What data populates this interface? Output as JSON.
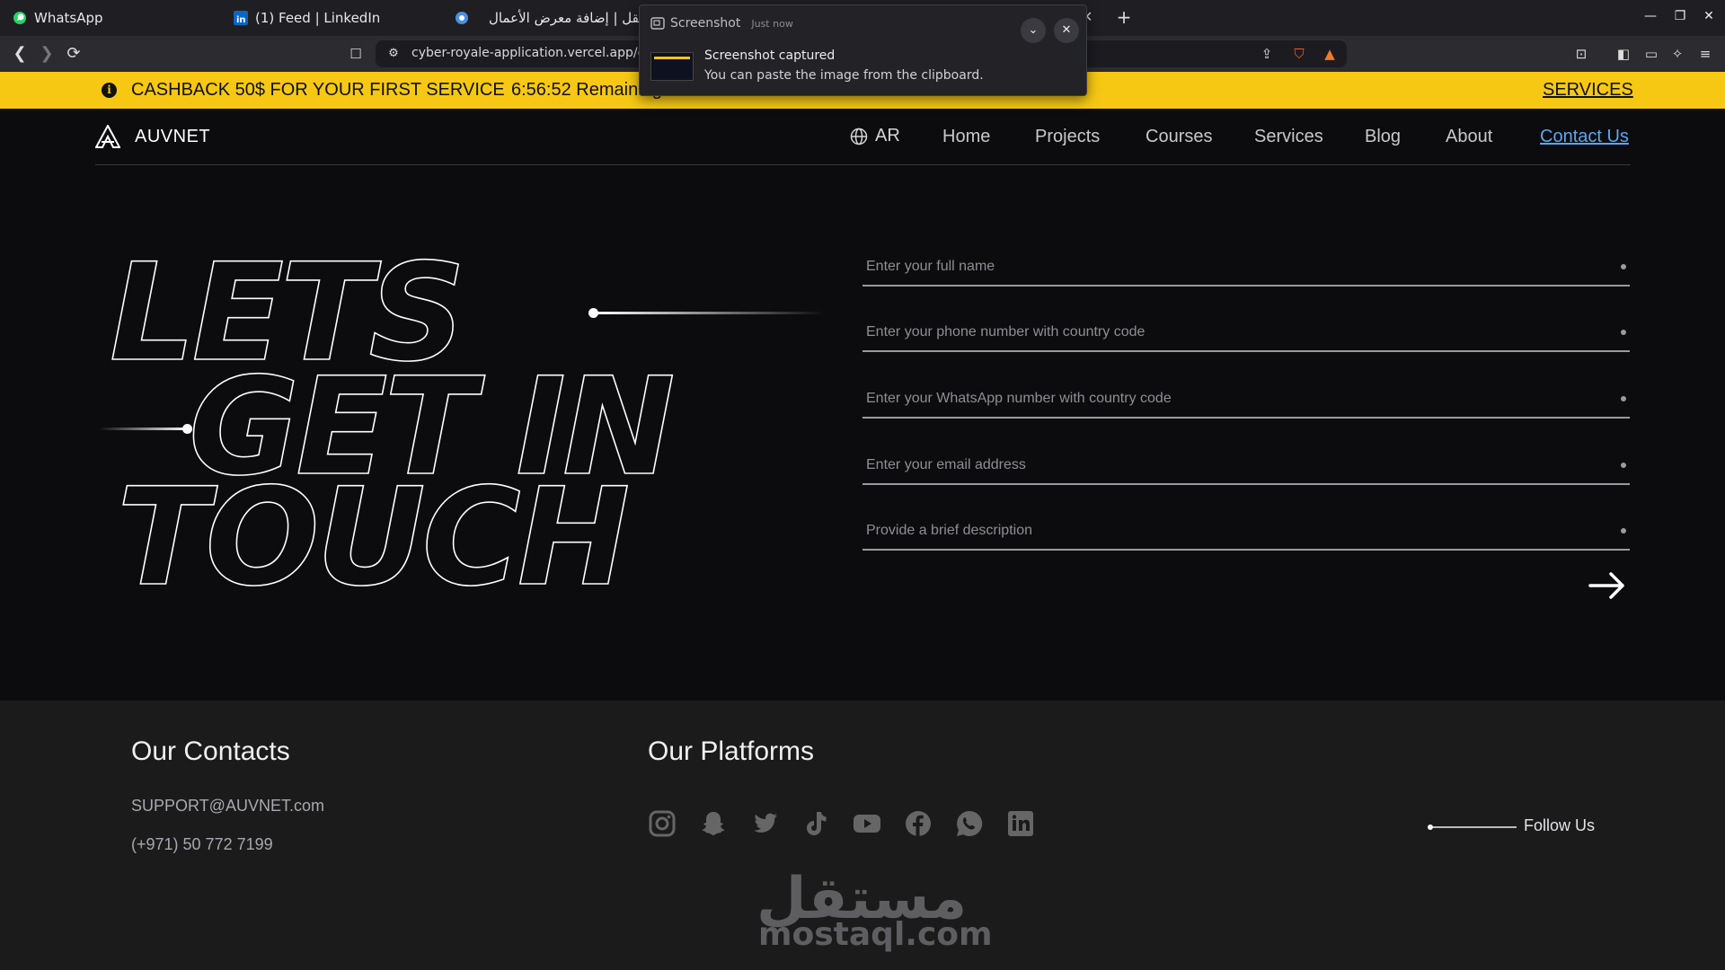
{
  "browser": {
    "tabs": [
      {
        "label": "WhatsApp",
        "icon": "whatsapp-icon"
      },
      {
        "label": "(1) Feed | LinkedIn",
        "icon": "linkedin-icon"
      },
      {
        "label": "مستقل | إضافة معرض الأعمال",
        "icon": "chrome-icon"
      }
    ],
    "new_tab": "+",
    "url": "cyber-royale-application.vercel.app/contact"
  },
  "notification": {
    "app": "Screenshot",
    "time": "Just now",
    "title": "Screenshot captured",
    "message": "You can paste the image from the clipboard."
  },
  "promo": {
    "text": "CASHBACK 50$ FOR YOUR FIRST SERVICE",
    "timer": "6:56:52 Remaining",
    "link": "SERVICES",
    "color": "#f6c814"
  },
  "header": {
    "brand": "AUVNET",
    "lang": "AR",
    "nav": [
      "Home",
      "Projects",
      "Courses",
      "Services",
      "Blog",
      "About",
      "Contact Us"
    ],
    "active": "Contact Us",
    "active_color": "#5aa7ee"
  },
  "hero": {
    "headline": [
      "LETS",
      "GET IN",
      "TOUCH"
    ]
  },
  "form": {
    "fields": [
      {
        "placeholder": "Enter your full name",
        "value": ""
      },
      {
        "placeholder": "Enter your phone number with country code",
        "value": ""
      },
      {
        "placeholder": "Enter your WhatsApp number with country code",
        "value": ""
      },
      {
        "placeholder": "Enter your email address",
        "value": ""
      },
      {
        "placeholder": "Provide a brief description",
        "value": ""
      }
    ],
    "submit_icon": "arrow-right-icon"
  },
  "footer": {
    "contacts_title": "Our Contacts",
    "email": "SUPPORT@AUVNET.com",
    "phone": "(+971) 50 772 7199",
    "platforms_title": "Our Platforms",
    "platforms": [
      "instagram-icon",
      "snapchat-icon",
      "twitter-icon",
      "tiktok-icon",
      "youtube-icon",
      "facebook-icon",
      "whatsapp-icon",
      "linkedin-icon"
    ],
    "follow": "Follow Us",
    "watermark_ar": "مستقل",
    "watermark_en": "mostaql.com"
  }
}
